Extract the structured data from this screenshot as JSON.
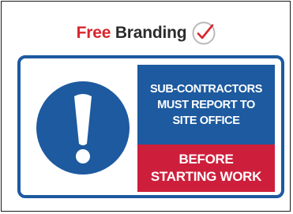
{
  "branding": {
    "free_label": "Free",
    "branding_label": "Branding",
    "icon": "checkmark-circle-icon",
    "free_color": "#d8262d",
    "check_color": "#d8262d"
  },
  "sign": {
    "symbol_icon": "exclamation-circle-icon",
    "border_color": "#1d5a9f",
    "upper_panel": {
      "color": "#1d5a9f",
      "lines": [
        "SUB-CONTRACTORS",
        "MUST REPORT TO",
        "SITE OFFICE"
      ]
    },
    "lower_panel": {
      "color": "#cd1f3b",
      "lines": [
        "BEFORE",
        "STARTING WORK"
      ]
    }
  }
}
